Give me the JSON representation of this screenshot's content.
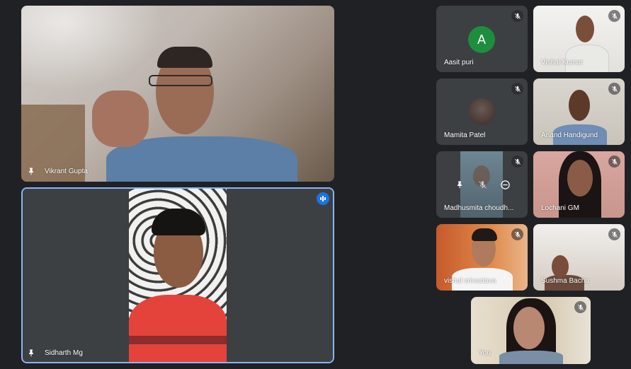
{
  "colors": {
    "background": "#202124",
    "tile": "#3c4043",
    "active_border": "#8ab4f8",
    "speaking_indicator": "#1a73e8",
    "avatar_green": "#1e8e3e"
  },
  "main_tiles": [
    {
      "name": "Vikrant Gupta",
      "pin_icon": "pin-icon"
    },
    {
      "name": "Sidharth Mg",
      "pin_icon": "pin-icon",
      "speaking": true
    }
  ],
  "grid_tiles": [
    {
      "name": "Aasit puri",
      "avatar_letter": "A",
      "muted": true
    },
    {
      "name": "Vishal Kumar",
      "muted": true
    },
    {
      "name": "Mamita Patel",
      "muted": true
    },
    {
      "name": "Anand Handigund",
      "muted": true
    },
    {
      "name": "Madhusmita choudh...",
      "muted": true
    },
    {
      "name": "Lochani GM",
      "muted": true
    },
    {
      "name": "vishal srivastava",
      "muted": true
    },
    {
      "name": "Sushma Bachu",
      "muted": true
    },
    {
      "name": "You",
      "muted": true
    }
  ],
  "hover_controls": [
    "pin-icon",
    "mic-off-icon",
    "remove-icon"
  ]
}
